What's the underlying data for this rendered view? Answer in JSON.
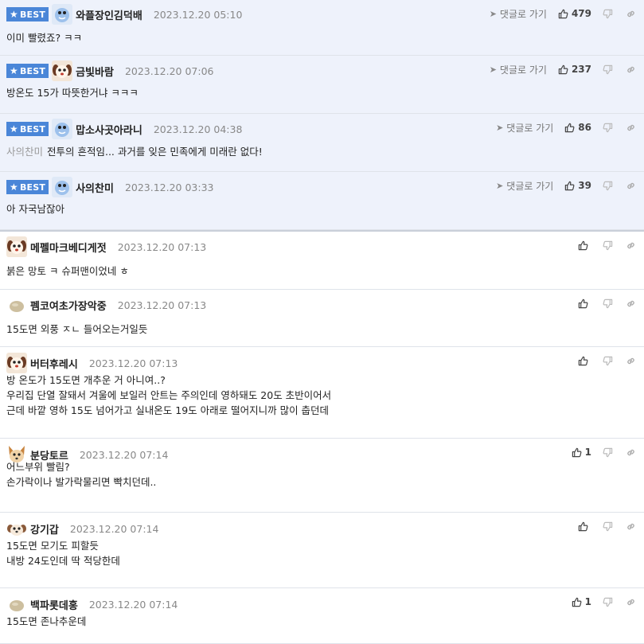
{
  "best_label": "BEST",
  "reply_label": "댓글로 가기",
  "comments": [
    {
      "best": true,
      "avatar": "blue-bird-avatar",
      "name": "와플장인김덕배",
      "date": "2023.12.20 05:10",
      "likes": "479",
      "prefix": "",
      "lines": [
        "이미 빨렸죠? ㅋㅋ"
      ]
    },
    {
      "best": true,
      "avatar": "brown-dog-avatar",
      "name": "금빛바람",
      "date": "2023.12.20 07:06",
      "likes": "237",
      "prefix": "",
      "lines": [
        "방온도 15가 따뜻한거냐 ㅋㅋㅋ"
      ]
    },
    {
      "best": true,
      "avatar": "blue-bird-avatar",
      "name": "맙소사곳아라니",
      "date": "2023.12.20 04:38",
      "likes": "86",
      "prefix": "사의찬미",
      "lines": [
        "전투의 흔적임... 과거를 잊은 민족에게 미래란 없다!"
      ]
    },
    {
      "best": true,
      "avatar": "blue-bird-avatar",
      "name": "사의찬미",
      "date": "2023.12.20 03:33",
      "likes": "39",
      "prefix": "",
      "lines": [
        "아 자국남잖아"
      ]
    },
    {
      "best": false,
      "avatar": "brown-dog-avatar",
      "name": "메펠마크베디게젓",
      "date": "2023.12.20 07:13",
      "likes": "",
      "prefix": "",
      "lines": [
        "붉은 망토 ㅋ 슈퍼맨이었네 ㅎ"
      ]
    },
    {
      "best": false,
      "avatar": "round-blob-avatar",
      "name": "펨코여초가장악중",
      "date": "2023.12.20 07:13",
      "likes": "",
      "prefix": "",
      "lines": [
        "15도면 외풍 ㅈㄴ 들어오는거일듯"
      ]
    },
    {
      "best": false,
      "avatar": "brown-dog-avatar",
      "name": "버터후레시",
      "date": "2023.12.20 07:13",
      "likes": "",
      "prefix": "",
      "lines": [
        "방 온도가 15도면 개추운 거 아니여..?",
        "우리집 단열 잘돼서 겨울에 보일러 안트는 주의인데 영하돼도 20도 초반이어서",
        "근데 바깥 영하 15도 넘어가고 실내온도 19도 아래로 떨어지니까 많이 춥던데"
      ]
    },
    {
      "best": false,
      "avatar": "corgi-avatar",
      "name": "분당토르",
      "date": "2023.12.20 07:14",
      "likes": "1",
      "prefix": "",
      "lines": [
        "어느부위 빨림?",
        "손가락이나 발가락물리면 빡치던데.."
      ]
    },
    {
      "best": false,
      "avatar": "puppy-avatar",
      "name": "강기갑",
      "date": "2023.12.20 07:14",
      "likes": "",
      "prefix": "",
      "lines": [
        "15도면 모기도 피할듯",
        "내방 24도인데 딱 적당한데"
      ]
    },
    {
      "best": false,
      "avatar": "round-blob-avatar",
      "name": "백파롯데홍",
      "date": "2023.12.20 07:14",
      "likes": "1",
      "prefix": "",
      "lines": [
        "15도면 존나추운데"
      ]
    }
  ]
}
